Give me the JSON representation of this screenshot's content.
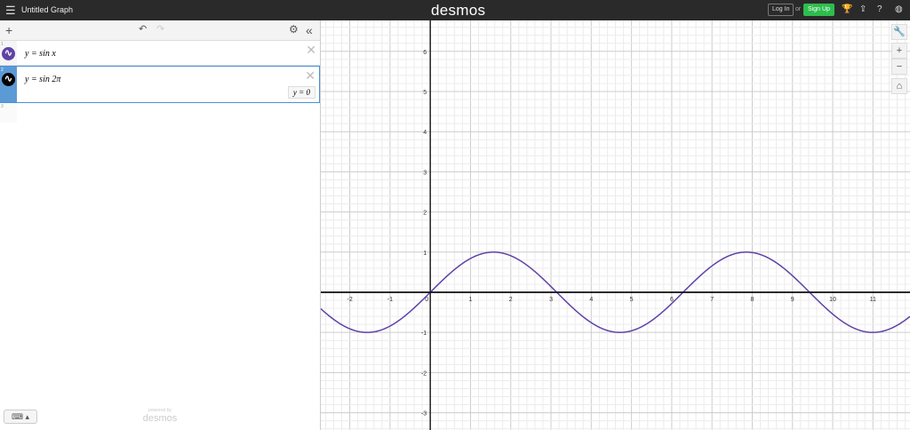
{
  "header": {
    "menu_icon": "hamburger-icon",
    "title": "Untitled Graph",
    "logo": "desmos",
    "login": "Log In",
    "or": "or",
    "signup": "Sign Up",
    "signup_color": "#2ebd4d",
    "icons": [
      "trophy-icon",
      "share-icon",
      "help-icon",
      "globe-icon"
    ]
  },
  "toolbar": {
    "add": "+",
    "undo": "↶",
    "redo": "↷",
    "settings": "⚙",
    "collapse": "«"
  },
  "expressions": [
    {
      "index": "1",
      "latex": "y = sin x",
      "color": "#6042a6"
    },
    {
      "index": "2",
      "latex": "y = sin 2π",
      "color": "#000000",
      "evaluation": "y = 0"
    },
    {
      "index": "3",
      "latex": ""
    }
  ],
  "footer": {
    "keyboard": "⌨ ▴",
    "powered_by": "powered by",
    "brand": "desmos"
  },
  "graph_controls": {
    "wrench": "🔧",
    "zoom_in": "+",
    "zoom_out": "−",
    "home": "⌂"
  },
  "chart_data": {
    "type": "line",
    "xlim": [
      -2.72,
      11.92
    ],
    "ylim": [
      -3.43,
      6.77
    ],
    "grid": true,
    "minor_grid_step": 0.2,
    "x_ticks": [
      "-2",
      "-1",
      "0",
      "1",
      "2",
      "3",
      "4",
      "5",
      "6",
      "7",
      "8",
      "9",
      "10",
      "11"
    ],
    "y_ticks": [
      "-3",
      "-2",
      "-1",
      "1",
      "2",
      "3",
      "4",
      "5",
      "6"
    ],
    "series": [
      {
        "function": "y = sin x",
        "color": "#6042a6"
      },
      {
        "function": "y = sin 2π",
        "color": "#000000"
      }
    ]
  }
}
